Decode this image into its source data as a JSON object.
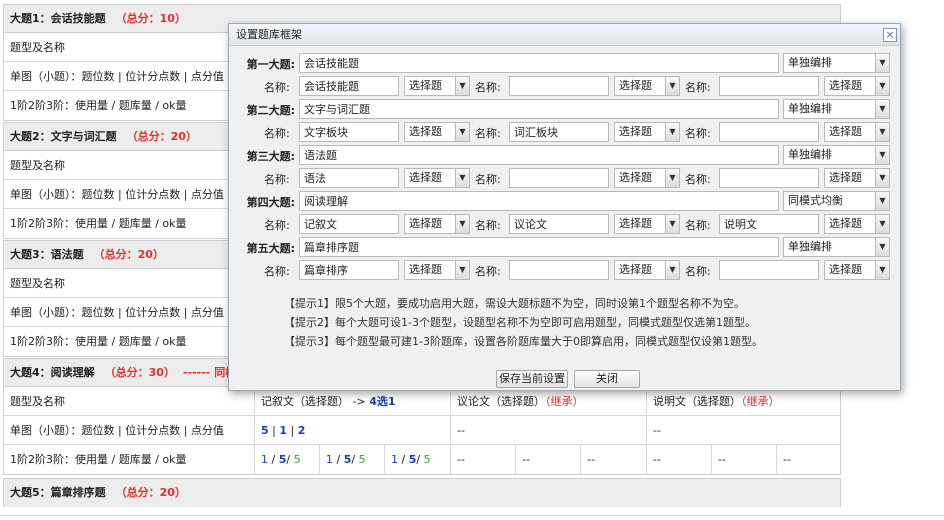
{
  "background": {
    "sections": [
      {
        "title": "大题1：会话技能题",
        "total": "（总分：10）",
        "extra": "",
        "rows": [
          "题型及名称",
          "单图（小题）：题位数 | 位计分点数 | 点分值",
          "1阶2阶3阶：使用量 / 题库量 / ok量"
        ]
      },
      {
        "title": "大题2：文字与词汇题",
        "total": "（总分：20）",
        "extra": "",
        "rows": [
          "题型及名称",
          "单图（小题）：题位数 | 位计分点数 | 点分值",
          "1阶2阶3阶：使用量 / 题库量 / ok量"
        ]
      },
      {
        "title": "大题3：语法题",
        "total": "（总分：20）",
        "extra": "",
        "rows": [
          "题型及名称",
          "单图（小题）：题位数 | 位计分点数 | 点分值",
          "1阶2阶3阶：使用量 / 题库量 / ok量"
        ]
      },
      {
        "title": "大题4：阅读理解",
        "total": "（总分：30）",
        "extra": "------ 同模式",
        "rows": [
          "题型及名称",
          "单图（小题）：题位数 | 位计分点数 | 点分值",
          "1阶2阶3阶：使用量 / 题库量 / ok量"
        ]
      },
      {
        "title": "大题5：篇章排序题",
        "total": "（总分：20）",
        "extra": "",
        "rows": []
      }
    ],
    "sec4_detail": {
      "type1_name": "记叙文",
      "type1_kind": "（选择题）",
      "arrow": "->",
      "pick": "4选1",
      "type2_name": "议论文",
      "type2_kind": "（选择题）",
      "type2_inherit": "（继承）",
      "type3_name": "说明文",
      "type3_kind": "（选择题）",
      "type3_inherit": "（继承）",
      "counts": [
        "5",
        "|",
        "1",
        "|",
        "2"
      ],
      "dash": "--",
      "usage": [
        {
          "a": "1",
          "b": "5",
          "c": "5"
        },
        {
          "a": "1",
          "b": "5",
          "c": "5"
        },
        {
          "a": "1",
          "b": "5",
          "c": "5"
        }
      ],
      "sep": "/"
    }
  },
  "dialog": {
    "title": "设置题库框架",
    "close_glyph": "×",
    "name_label": "名称:",
    "select_default": "选择题",
    "rows": [
      {
        "label": "第一大题:",
        "title": "会话技能题",
        "mode": "单独编排",
        "names": [
          "会话技能题",
          "",
          ""
        ]
      },
      {
        "label": "第二大题:",
        "title": "文字与词汇题",
        "mode": "单独编排",
        "names": [
          "文字板块",
          "词汇板块",
          ""
        ]
      },
      {
        "label": "第三大题:",
        "title": "语法题",
        "mode": "单独编排",
        "names": [
          "语法",
          "",
          ""
        ]
      },
      {
        "label": "第四大题:",
        "title": "阅读理解",
        "mode": "同模式均衡",
        "names": [
          "记叙文",
          "议论文",
          "说明文"
        ]
      },
      {
        "label": "第五大题:",
        "title": "篇章排序题",
        "mode": "单独编排",
        "names": [
          "篇章排序",
          "",
          ""
        ]
      }
    ],
    "tips": [
      "【提示1】限5个大题，要成功启用大题，需设大题标题不为空，同时设第1个题型名称不为空。",
      "【提示2】每个大题可设1-3个题型，设题型名称不为空即可启用题型，同模式题型仅选第1题型。",
      "【提示3】每个题型最可建1-3阶题库，设置各阶题库量大于0即算启用，同模式题型仅设第1题型。"
    ],
    "save_label": "保存当前设置",
    "close_label": "关闭"
  }
}
